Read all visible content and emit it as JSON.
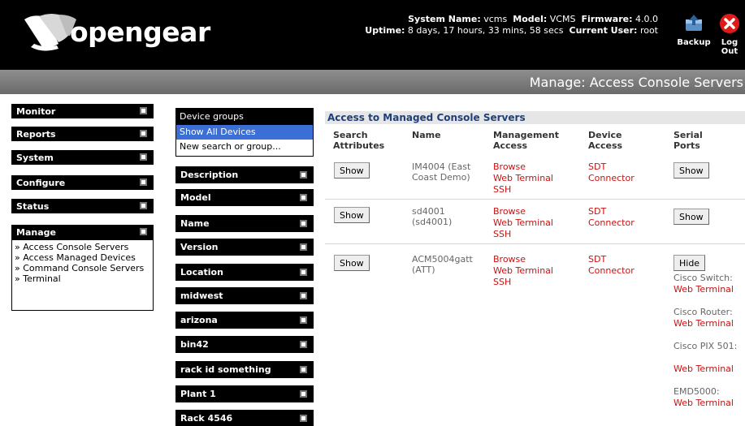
{
  "header": {
    "brand": "opengear",
    "system_name_label": "System Name:",
    "system_name": "vcms",
    "model_label": "Model:",
    "model": "VCMS",
    "firmware_label": "Firmware:",
    "firmware": "4.0.0",
    "uptime_label": "Uptime:",
    "uptime": "8 days, 17 hours, 33 mins, 58 secs",
    "current_user_label": "Current User:",
    "current_user": "root",
    "backup_label": "Backup",
    "logout_label": "Log Out"
  },
  "page_title": "Manage: Access Console Servers",
  "nav": {
    "monitor": "Monitor",
    "reports": "Reports",
    "system": "System",
    "configure": "Configure",
    "status": "Status",
    "manage": "Manage",
    "manage_items": [
      "» Access Console Servers",
      "» Access Managed Devices",
      "» Command Console Servers",
      "» Terminal"
    ]
  },
  "groups": {
    "header": "Device groups",
    "list": [
      "Show All Devices",
      "New search or group..."
    ],
    "bars": [
      "Description",
      "Model",
      "Name",
      "Version",
      "Location",
      "midwest",
      "arizona",
      "bin42",
      "rack id something",
      "Plant 1",
      "Rack 4546"
    ]
  },
  "table": {
    "heading": "Access to Managed Console Servers",
    "col_search": "Search Attributes",
    "col_name": "Name",
    "col_mgmt": "Management Access",
    "col_device": "Device Access",
    "col_serial": "Serial Ports",
    "rows": [
      {
        "search_btn": "Show",
        "name": "IM4004 (East Coast Demo)",
        "mgmt": [
          "Browse",
          "Web Terminal",
          "SSH"
        ],
        "device": [
          "SDT",
          "Connector"
        ],
        "serial_btn": "Show"
      },
      {
        "search_btn": "Show",
        "name": "sd4001 (sd4001)",
        "mgmt": [
          "Browse",
          "Web Terminal",
          "SSH"
        ],
        "device": [
          "SDT",
          "Connector"
        ],
        "serial_btn": "Show"
      },
      {
        "search_btn": "Show",
        "name": "ACM5004gatt (ATT)",
        "mgmt": [
          "Browse",
          "Web Terminal",
          "SSH"
        ],
        "device": [
          "SDT",
          "Connector"
        ],
        "serial_btn": "Hide",
        "ports": [
          {
            "label": "Cisco Switch:",
            "link": "Web Terminal"
          },
          {
            "label": "Cisco Router:",
            "link": "Web Terminal"
          },
          {
            "label": "Cisco PIX 501:",
            "link": "Web Terminal"
          },
          {
            "label": "EMD5000:",
            "link": "Web Terminal"
          }
        ]
      }
    ]
  }
}
